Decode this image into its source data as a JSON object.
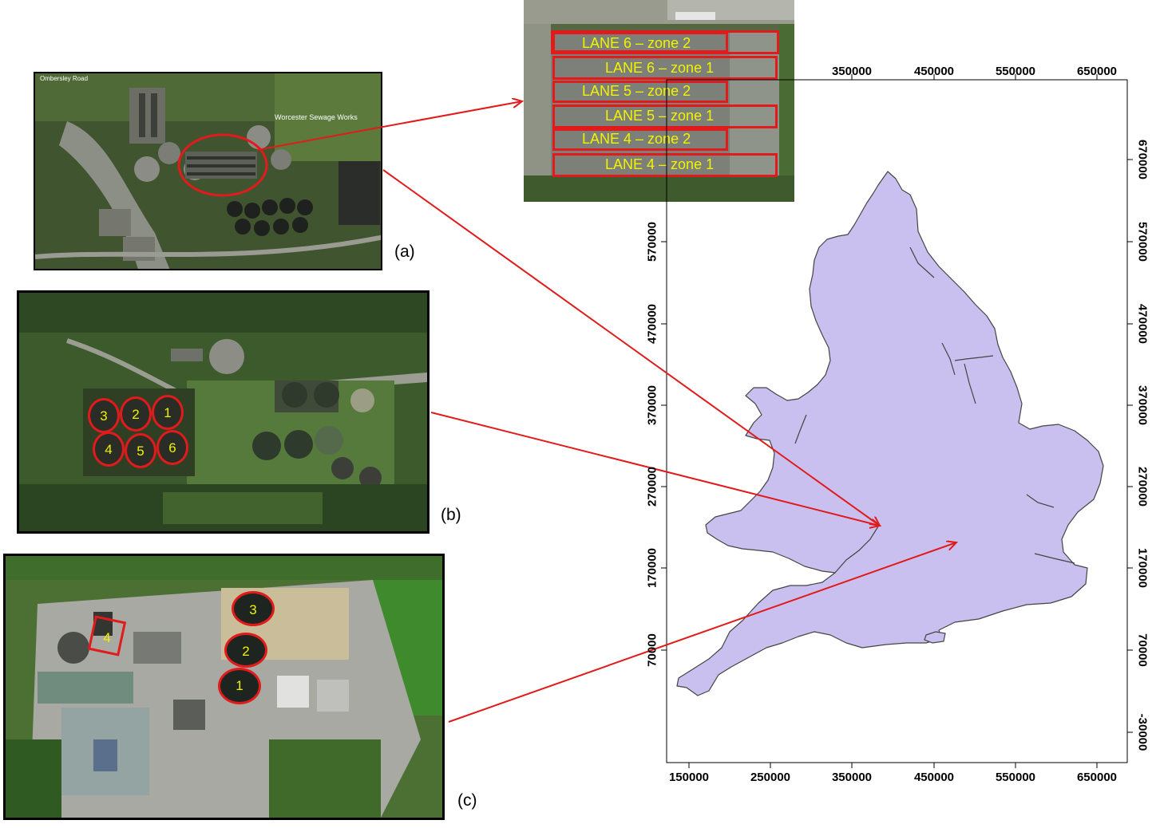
{
  "captions": {
    "a": "(a)",
    "b": "(b)",
    "c": "(c)"
  },
  "site_a_labels": {
    "sign": "Worcester Sewage Works",
    "road": "Ombersley Road"
  },
  "lanes": [
    "LANE 6 – zone 2",
    "LANE 6 – zone 1",
    "LANE 5 – zone 2",
    "LANE 5 – zone 1",
    "LANE 4 – zone 2",
    "LANE 4 – zone 1"
  ],
  "site_b_tanks": [
    "3",
    "2",
    "1",
    "4",
    "5",
    "6"
  ],
  "site_c_tanks": [
    "3",
    "2",
    "1",
    "4"
  ],
  "map": {
    "x_ticks": [
      "150000",
      "250000",
      "350000",
      "450000",
      "550000",
      "650000"
    ],
    "y_ticks": [
      "670000",
      "570000",
      "470000",
      "370000",
      "270000",
      "170000",
      "70000",
      "-30000"
    ],
    "y_ticks_left": [
      "570000",
      "470000",
      "370000",
      "270000",
      "170000",
      "70000"
    ],
    "x_ticks_top": [
      "350000",
      "450000",
      "550000",
      "650000"
    ],
    "fill_color": "#c9c0ef",
    "edge_color": "#444444"
  },
  "colors": {
    "highlight": "#e11b1b",
    "label_text": "#f2f200",
    "arrow": "#e11b1b"
  }
}
